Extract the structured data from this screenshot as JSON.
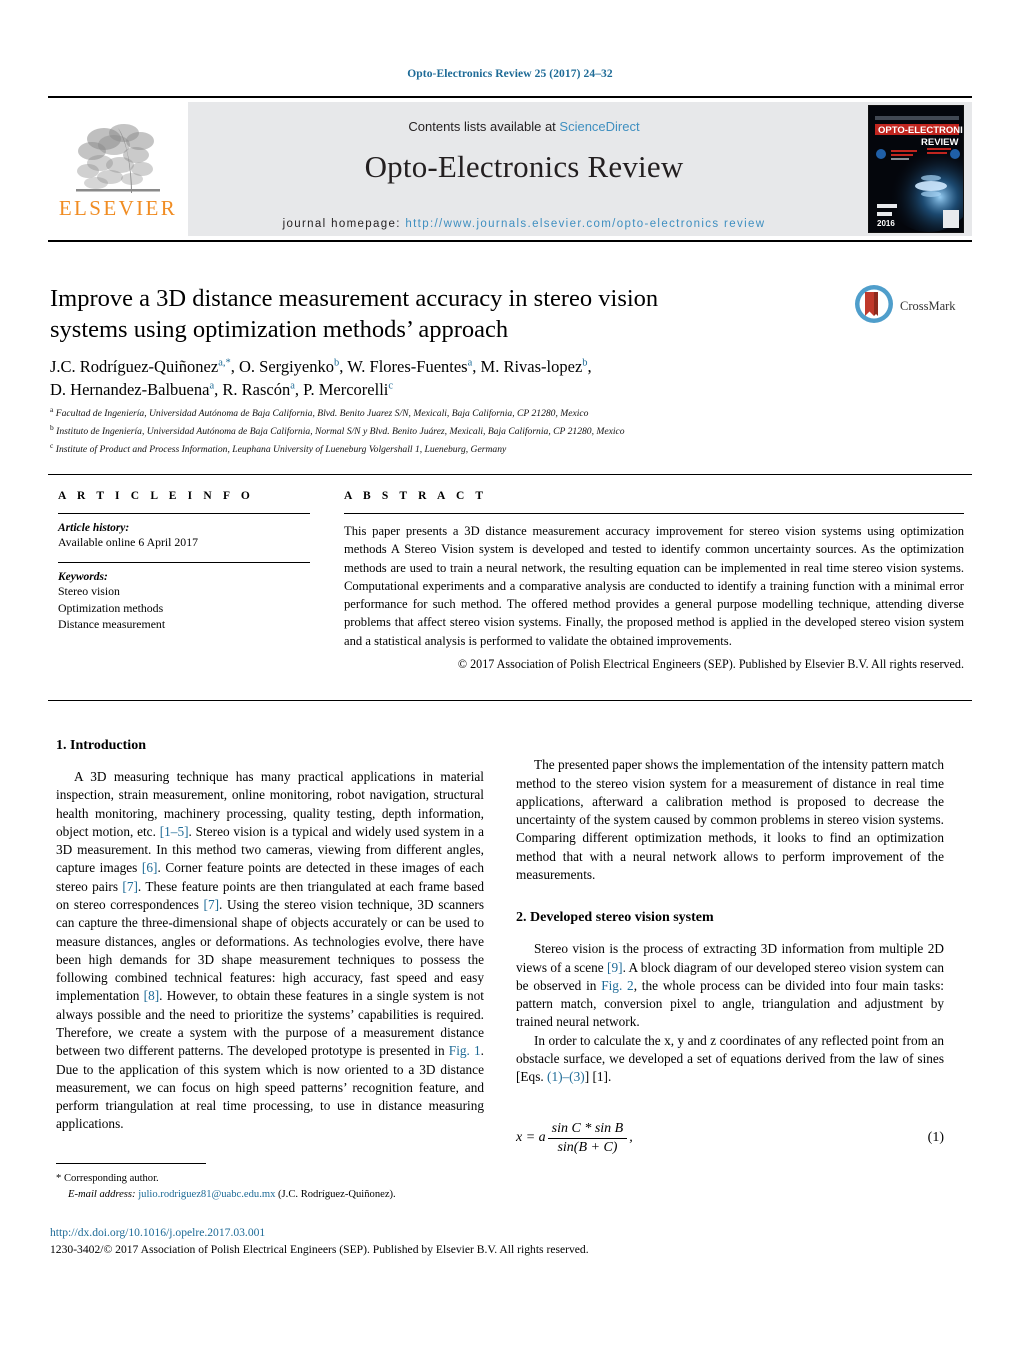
{
  "running_head": "Opto-Electronics Review 25 (2017) 24–32",
  "masthead": {
    "publisher_name": "ELSEVIER",
    "publisher_logo_alt": "elsevier-tree-logo",
    "contents_prefix": "Contents lists available at ",
    "contents_link": "ScienceDirect",
    "journal_title": "Opto-Electronics Review",
    "homepage_prefix": "journal homepage: ",
    "homepage_url": "http://www.journals.elsevier.com/opto-electronics review",
    "cover": {
      "line1": "OPTO-ELECTRONICS",
      "line2": "REVIEW",
      "volume": "Volume 24",
      "issue": "Number 2",
      "year": "2016"
    }
  },
  "article": {
    "title": "Improve a 3D distance measurement accuracy in stereo vision systems using optimization methods’ approach",
    "crossmark_label": "CrossMark",
    "authors_line1": "J.C. Rodríguez-Quiñonez",
    "authors": [
      {
        "name": "J.C. Rodríguez-Quiñonez",
        "sup": "a,*"
      },
      {
        "name": "O. Sergiyenko",
        "sup": "b"
      },
      {
        "name": "W. Flores-Fuentes",
        "sup": "a"
      },
      {
        "name": "M. Rivas-lopez",
        "sup": "b"
      },
      {
        "name": "D. Hernandez-Balbuena",
        "sup": "a"
      },
      {
        "name": "R. Rascón",
        "sup": "a"
      },
      {
        "name": "P. Mercorelli",
        "sup": "c"
      }
    ],
    "affiliations": [
      {
        "marker": "a",
        "text": "Facultad de Ingeniería, Universidad Autónoma de Baja California, Blvd. Benito Juarez S/N, Mexicali, Baja California, CP 21280, Mexico"
      },
      {
        "marker": "b",
        "text": "Instituto de Ingeniería, Universidad Autónoma de Baja California, Normal S/N y Blvd. Benito Juárez, Mexicali, Baja California, CP 21280, Mexico"
      },
      {
        "marker": "c",
        "text": "Institute of Product and Process Information, Leuphana University of Lueneburg Volgershall 1, Lueneburg, Germany"
      }
    ]
  },
  "info": {
    "heading": "A R T I C L E   I N F O",
    "history_label": "Article history:",
    "history_value": "Available online 6 April 2017",
    "keywords_label": "Keywords:",
    "keywords": [
      "Stereo vision",
      "Optimization methods",
      "Distance measurement"
    ]
  },
  "abstract": {
    "heading": "A B S T R A C T",
    "text": "This paper presents a 3D distance measurement accuracy improvement for stereo vision systems using optimization methods A Stereo Vision system is developed and tested to identify common uncertainty sources. As the optimization methods are used to train a neural network, the resulting equation can be implemented in real time stereo vision systems. Computational experiments and a comparative analysis are conducted to identify a training function with a minimal error performance for such method. The offered method provides a general purpose modelling technique, attending diverse problems that affect stereo vision systems. Finally, the proposed method is applied in the developed stereo vision system and a statistical analysis is performed to validate the obtained improvements.",
    "copyright": "© 2017 Association of Polish Electrical Engineers (SEP). Published by Elsevier B.V. All rights reserved."
  },
  "sections": {
    "intro_heading": "1.  Introduction",
    "intro_p1_a": "A 3D measuring technique has many practical applications in material inspection, strain measurement, online monitoring, robot navigation, structural health monitoring, machinery processing, quality testing, depth information, object motion, etc. ",
    "intro_ref_1_5": "[1–5]",
    "intro_p1_b": ". Stereo vision is a typical and widely used system in a 3D measurement. In this method two cameras, viewing from different angles, capture images ",
    "intro_ref_6": "[6]",
    "intro_p1_c": ". Corner feature points are detected in these images of each stereo pairs ",
    "intro_ref_7a": "[7]",
    "intro_p1_d": ". These feature points are then triangulated at each frame based on stereo correspondences ",
    "intro_ref_7b": "[7]",
    "intro_p1_e": ". Using the stereo vision technique, 3D scanners can capture the three-dimensional shape of objects accurately or can be used to measure distances, angles or deformations. As technologies evolve, there have been high demands for 3D shape measurement techniques to possess the following combined technical features: high accuracy, fast speed and easy implementation ",
    "intro_ref_8": "[8]",
    "intro_p1_f": ". However, to obtain these features in a single system is not always possible and the need to prioritize the systems’ capabilities is required. Therefore, we create a system with the purpose of a measurement distance between two different patterns. The developed prototype is presented in ",
    "intro_ref_fig1": "Fig. 1",
    "intro_p1_g": ". Due to the application of this system which is now oriented to a 3D distance measurement, we can focus on high speed patterns’ recognition feature, and perform triangulation at real time processing, to use in distance measuring applications.",
    "intro_p2": "The presented paper shows the implementation of the intensity pattern match method to the stereo vision system for a measurement of distance in real time applications, afterward a calibration method is proposed to decrease the uncertainty of the system caused by common problems in stereo vision systems. Comparing different optimization methods, it looks to find an optimization method that with a neural network allows to perform improvement of the measurements.",
    "sec2_heading": "2.  Developed stereo vision system",
    "sec2_p1_a": "Stereo vision is the process of extracting 3D information from multiple 2D views of a scene ",
    "sec2_ref_9": "[9]",
    "sec2_p1_b": ". A block diagram of our developed stereo vision system can be observed in ",
    "sec2_ref_fig2": "Fig. 2",
    "sec2_p1_c": ", the whole process can be divided into four main tasks: pattern match, conversion pixel to angle, triangulation and adjustment by trained neural network.",
    "sec2_p2_a": "In order to calculate the x, y and z coordinates of any reflected point from an obstacle surface, we developed a set of equations derived from the law of sines [Eqs. ",
    "sec2_ref_eqs": "(1)–(3)",
    "sec2_p2_b": "] [1]."
  },
  "equation": {
    "lhs": "x = a",
    "numerator": "sin C * sin B",
    "denominator": "sin(B + C)",
    "trailing": ",",
    "number": "(1)"
  },
  "footnotes": {
    "corresponding_marker": "*",
    "corresponding_text": "Corresponding author.",
    "email_label": "E-mail address:",
    "email": "julio.rodriguez81@uabc.edu.mx",
    "email_owner": "(J.C. Rodríguez-Quiñonez).",
    "doi": "http://dx.doi.org/10.1016/j.opelre.2017.03.001",
    "issn_line": "1230-3402/© 2017 Association of Polish Electrical Engineers (SEP). Published by Elsevier B.V. All rights reserved."
  },
  "colors": {
    "link": "#1d6a96",
    "elsevier_orange": "#f08c22",
    "masthead_grey": "#e7e8ea",
    "sciencedirect_blue": "#3f8fc0"
  }
}
